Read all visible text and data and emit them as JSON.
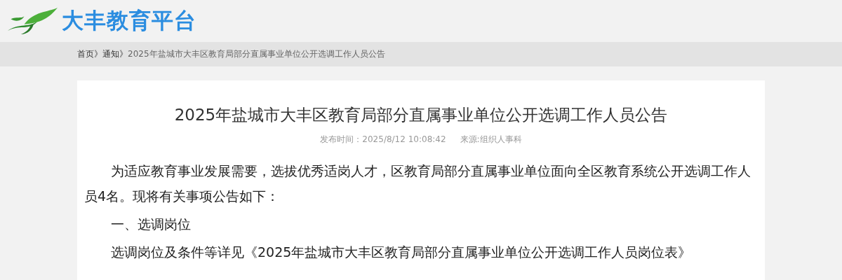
{
  "header": {
    "site_name": "大丰教育平台"
  },
  "breadcrumb": [
    {
      "label": "首页",
      "kind": "link"
    },
    {
      "label": "》",
      "kind": "sep"
    },
    {
      "label": "通知",
      "kind": "link"
    },
    {
      "label": "》",
      "kind": "sep"
    },
    {
      "label": "2025年盐城市大丰区教育局部分直属事业单位公开选调工作人员公告",
      "kind": "current"
    }
  ],
  "article": {
    "title": "2025年盐城市大丰区教育局部分直属事业单位公开选调工作人员公告",
    "publish_time": "发布时间：2025/8/12 10:08:42",
    "source": "来源:组织人事科",
    "paragraphs": [
      "为适应教育事业发展需要，选拔优秀适岗人才，区教育局部分直属事业单位面向全区教育系统公开选调工作人员4名。现将有关事项公告如下：",
      "一、选调岗位",
      "选调岗位及条件等详见《2025年盐城市大丰区教育局部分直属事业单位公开选调工作人员岗位表》"
    ]
  }
}
